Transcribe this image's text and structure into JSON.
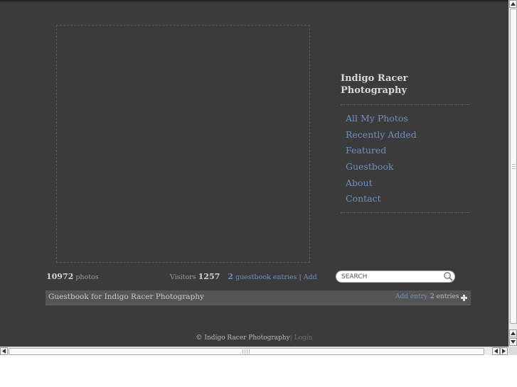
{
  "site": {
    "title": "Indigo Racer Photography"
  },
  "nav": {
    "items": [
      "All My Photos",
      "Recently Added",
      "Featured",
      "Guestbook",
      "About",
      "Contact"
    ]
  },
  "stats": {
    "photo_count": "10972",
    "photo_label": "photos",
    "visitors_label": "Visitors",
    "visitors_count": "1257",
    "guestbook_count": "2",
    "guestbook_label": "guestbook entries",
    "separator": "|",
    "add_label": "Add"
  },
  "search": {
    "placeholder": "SEARCH"
  },
  "guestbook": {
    "title": "Guestbook for Indigo Racer Photography",
    "add_entry_label": "Add entry",
    "entries_text": "2 entries"
  },
  "footer": {
    "copyright": "© Indigo Racer Photography",
    "separator": "|",
    "login_label": "Login"
  },
  "colors": {
    "background": "#3b3b3b",
    "link": "#6e8fbf",
    "bar": "#555555"
  },
  "icons": {
    "search": "magnifier-icon",
    "plus": "plus-icon"
  }
}
